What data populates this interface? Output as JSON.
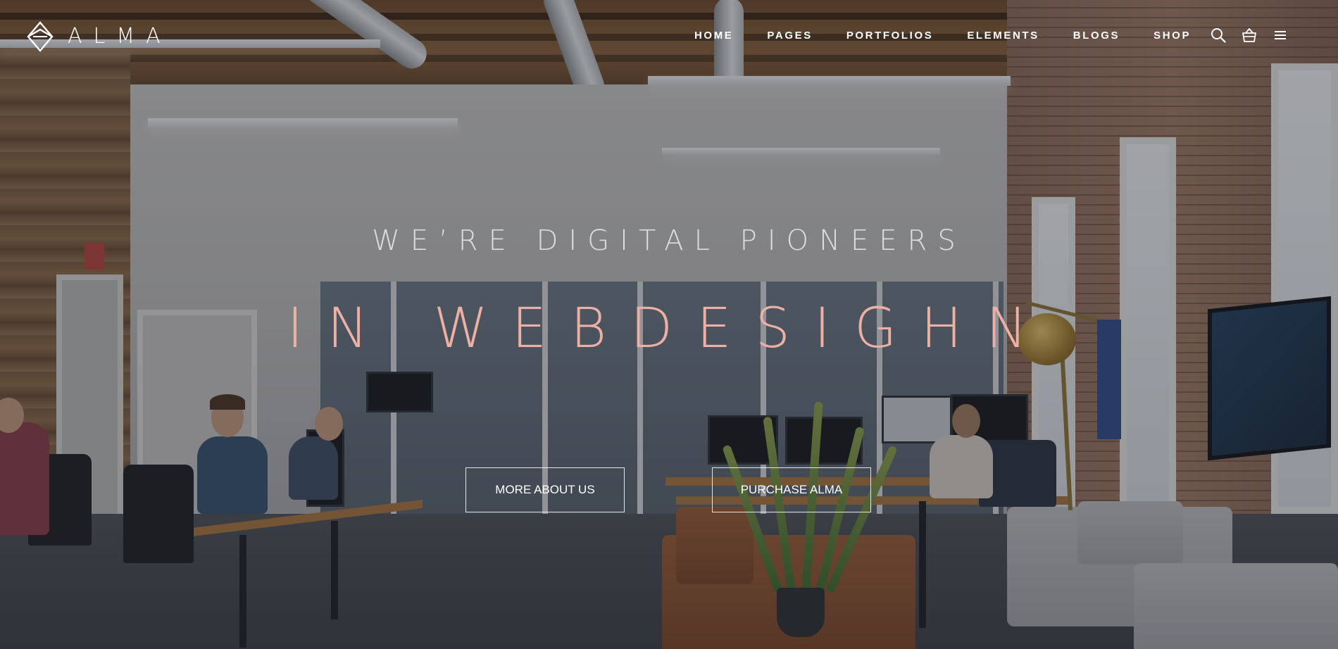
{
  "brand": {
    "logo_text": "ALMA",
    "logo_icon": "diamond-logo-icon"
  },
  "nav": {
    "items": [
      {
        "label": "HOME"
      },
      {
        "label": "PAGES"
      },
      {
        "label": "PORTFOLIOS"
      },
      {
        "label": "ELEMENTS"
      },
      {
        "label": "BLOGS"
      },
      {
        "label": "SHOP"
      }
    ],
    "icons": [
      "search-icon",
      "basket-icon",
      "menu-icon"
    ]
  },
  "hero": {
    "eyebrow": "WE’RE DIGITAL PIONEERS",
    "headline": "IN WEBDESIGHN",
    "buttons": {
      "about_label": "MORE ABOUT US",
      "purchase_label": "PURCHASE ALMA"
    }
  },
  "colors": {
    "headline": "#ecb0a4",
    "eyebrow": "#dedcde",
    "nav_text": "#ffffff",
    "overlay": "#1c1f28"
  }
}
